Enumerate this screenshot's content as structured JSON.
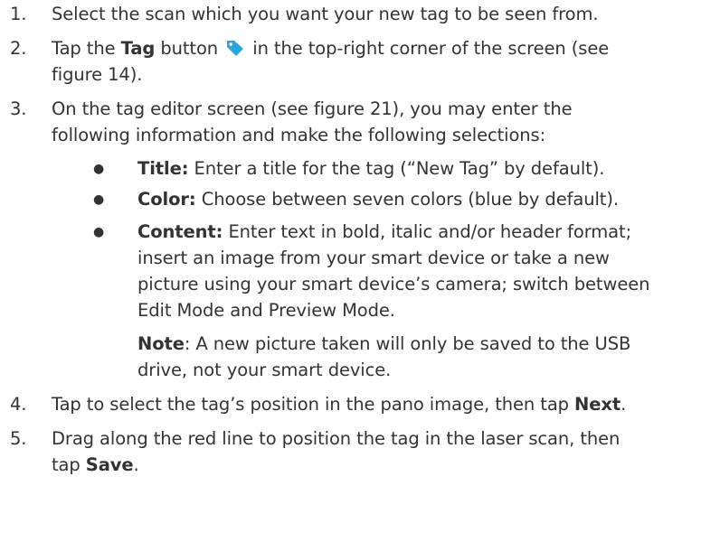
{
  "steps": [
    {
      "number": "1.",
      "lines": [
        "Select the scan which you want your new tag to be seen from."
      ]
    },
    {
      "number": "2.",
      "line1_pre": "Tap the ",
      "line1_bold": "Tag",
      "line1_mid": " button ",
      "line1_post": " in the top-right corner of the screen (see",
      "line2": "figure 14)."
    },
    {
      "number": "3.",
      "line1": "On the tag editor screen (see figure 21), you may enter the",
      "line2": "following information and make the following selections:"
    },
    {
      "number": "4.",
      "pre": "Tap to select the tag’s position in the pano image, then tap ",
      "bold": "Next",
      "post": "."
    },
    {
      "number": "5.",
      "line1": "Drag along the red line to position the tag in the laser scan, then",
      "line2_pre": "tap ",
      "line2_bold": "Save",
      "line2_post": "."
    }
  ],
  "bullets": [
    {
      "marker": "●",
      "bold": "Title:",
      "text": " Enter a title for the tag (“New Tag” by default)."
    },
    {
      "marker": "●",
      "bold": "Color:",
      "text": " Choose between seven colors (blue by default)."
    },
    {
      "marker": "●",
      "bold": "Content:",
      "text": " Enter text in bold, italic and/or header format;",
      "continuation": [
        "insert an image from your smart device or take a new",
        "picture using your smart device’s camera; switch between",
        "Edit Mode and Preview Mode."
      ],
      "note_bold": "Note",
      "note_text": ": A new picture taken will only be saved to the USB",
      "note_continuation": "drive, not your smart device."
    }
  ],
  "icons": {
    "tag": "tag-icon",
    "tag_color": "#2aa5e0"
  }
}
